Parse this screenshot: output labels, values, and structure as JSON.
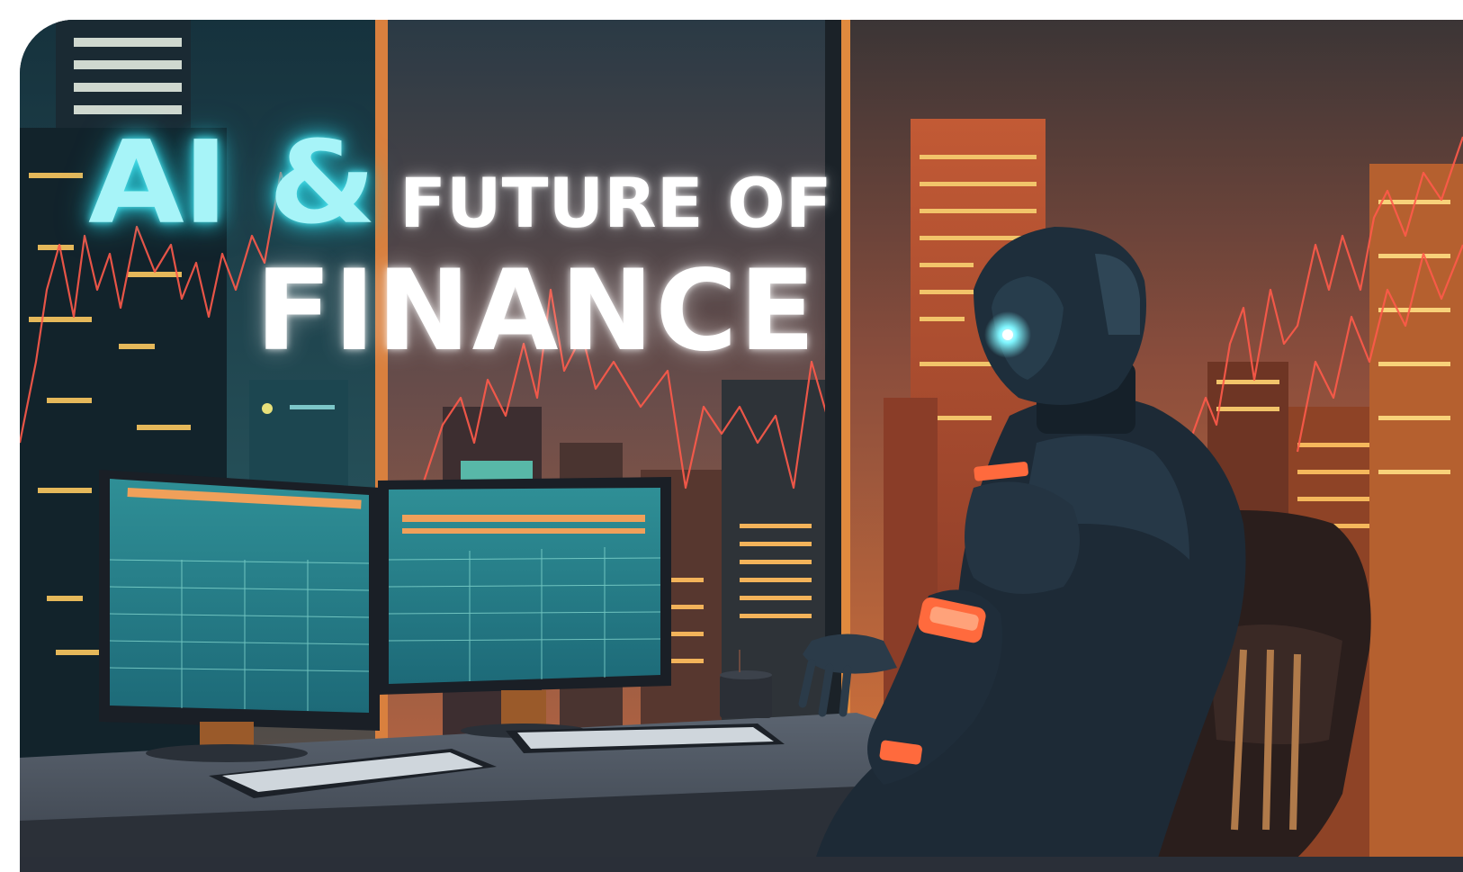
{
  "headline": {
    "line1_highlight": "AI &",
    "line1_rest": "FUTURE OF",
    "line2": "FINANCE"
  },
  "colors": {
    "glow_cyan": "#4fe3ee",
    "title_white": "#ffffff",
    "city_orange": "#e8743a",
    "night_teal": "#1f4b5a",
    "robot_dark": "#1d2a36",
    "robot_accent": "#ff6a3d"
  },
  "icons": {
    "robot": "robot-figure-icon",
    "monitors": "trading-monitor-icon",
    "chart": "price-chart-line-icon"
  }
}
